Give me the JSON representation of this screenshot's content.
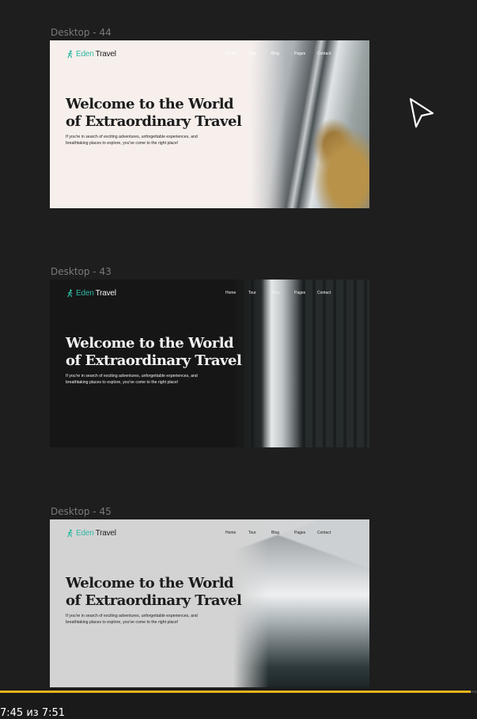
{
  "frames": [
    {
      "label": "Desktop - 44"
    },
    {
      "label": "Desktop - 43"
    },
    {
      "label": "Desktop - 45"
    }
  ],
  "site": {
    "logo_eden": "Eden",
    "logo_travel": "Travel",
    "nav": [
      "Home",
      "Tour",
      "Blog",
      "Pages",
      "Contact"
    ],
    "headline_line1": "Welcome to the World",
    "headline_line2": "of Extraordinary Travel",
    "subtext_line1": "If you're in search of exciting adventures, unforgettable experiences, and",
    "subtext_line2": "breathtaking places to explore, you've come to the right place!"
  },
  "player": {
    "time": "7:45 из 7:51",
    "progress": 0.987
  },
  "colors": {
    "brand_teal": "#2fb8a3",
    "progress_accent": "#e8b21c",
    "canvas": "#1e1e1e"
  },
  "icons": [
    "hiker-logo-icon",
    "cursor-arrow-icon"
  ]
}
